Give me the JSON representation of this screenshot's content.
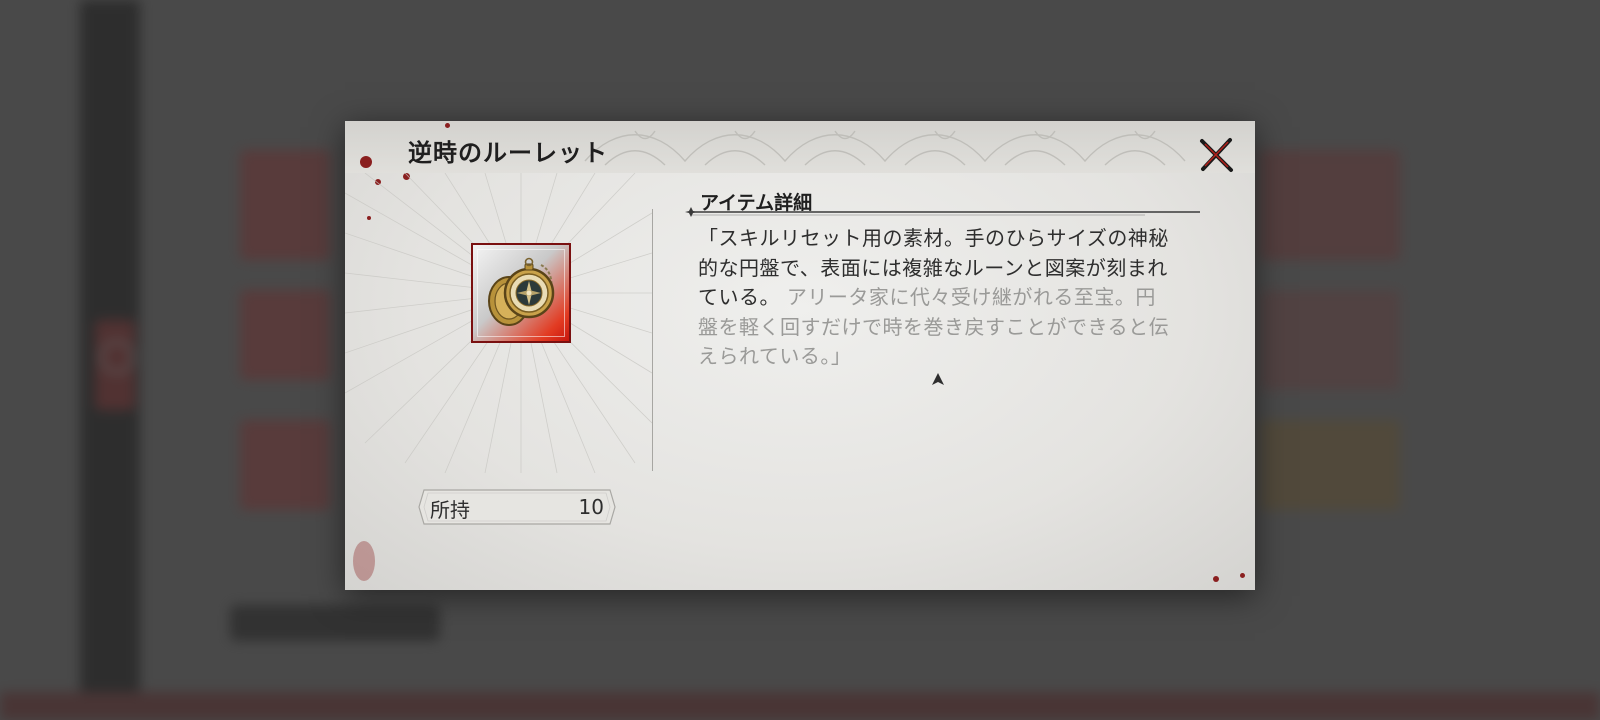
{
  "dialog": {
    "title": "逆時のルーレット",
    "close_icon": "close-x-icon"
  },
  "item": {
    "icon": "pocket-watch-icon",
    "frame_color": "#d9241a",
    "own_label": "所持",
    "own_count": "10"
  },
  "details": {
    "section_title": "アイテム詳細",
    "description_main": "「スキルリセット用の素材。手のひらサイズの神秘的な円盤で、表面には複雑なルーンと図案が刻まれている。",
    "description_faded": "アリータ家に代々受け継がれる至宝。円盤を軽く回すだけで時を巻き戻すことができると伝えられている。」",
    "more_indicator_icon": "caret-up-icon"
  }
}
